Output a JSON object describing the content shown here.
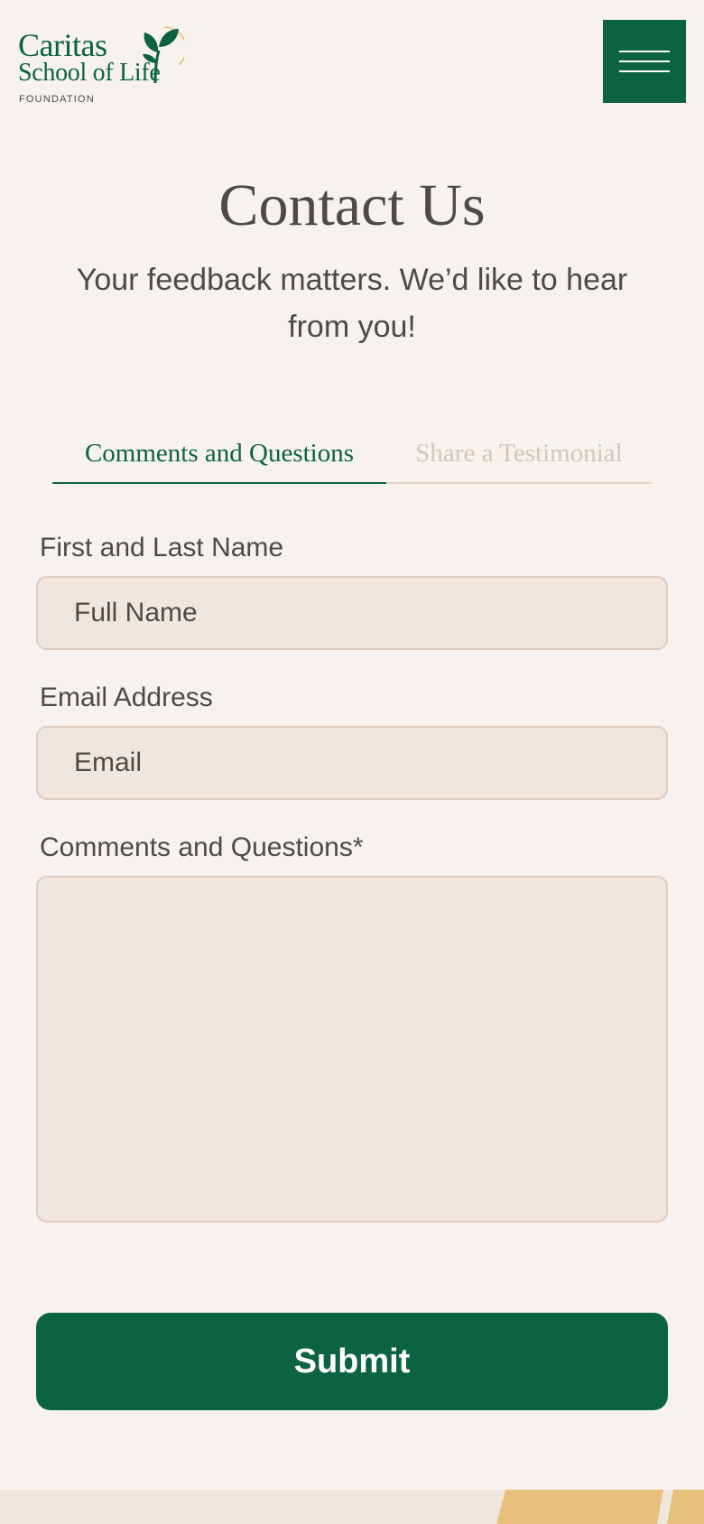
{
  "brand": {
    "name_line1": "Caritas",
    "name_line2": "School of Life",
    "name_line3": "FOUNDATION",
    "logo_icon": "leaf-sprout-icon",
    "primary_color": "#0b6342",
    "accent_color": "#e8c07c"
  },
  "header": {
    "menu_icon": "hamburger-menu-icon"
  },
  "page": {
    "title": "Contact Us",
    "subtitle": "Your feedback matters. We’d like to hear from you!"
  },
  "tabs": [
    {
      "label": "Comments and Questions",
      "active": true
    },
    {
      "label": "Share a Testimonial",
      "active": false
    }
  ],
  "form": {
    "name_label": "First and Last Name",
    "name_placeholder": "Full Name",
    "email_label": "Email Address",
    "email_placeholder": "Email",
    "comments_label": "Comments and Questions*",
    "comments_value": "",
    "submit_label": "Submit"
  }
}
